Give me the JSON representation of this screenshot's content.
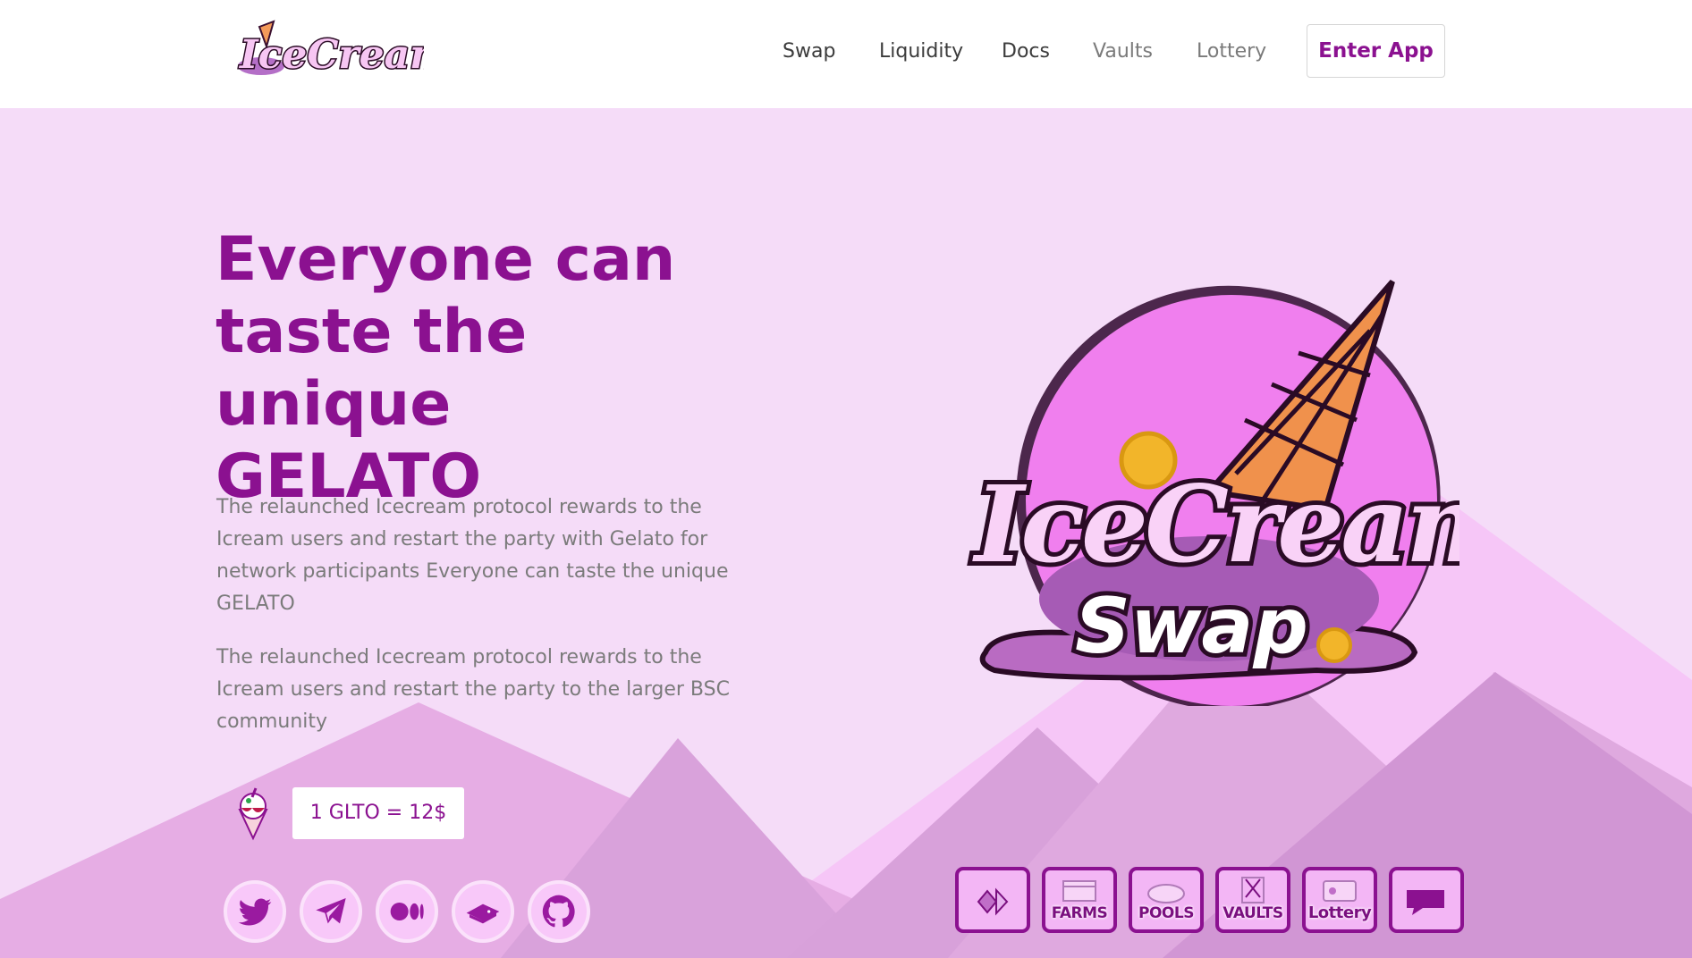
{
  "header": {
    "logo_text": "IceCream",
    "nav": [
      {
        "label": "Swap",
        "muted": false
      },
      {
        "label": "Liquidity",
        "muted": false
      },
      {
        "label": "Docs",
        "muted": false
      },
      {
        "label": "Vaults",
        "muted": true
      },
      {
        "label": "Lottery",
        "muted": true
      }
    ],
    "enter_app_label": "Enter App"
  },
  "hero": {
    "title_lines": [
      "Everyone can",
      "taste the unique",
      "GELATO"
    ],
    "paragraph_1": "The relaunched Icecream protocol rewards to the Icream users and restart the party with Gelato for network participants Everyone can taste the unique GELATO",
    "paragraph_2": "The relaunched Icecream protocol rewards to the Icream users and restart the party to the larger BSC community",
    "price": "1 GLTO = 12$",
    "art_text": {
      "line1": "IceCream",
      "line2": "Swap"
    }
  },
  "social_links": [
    {
      "icon": "twitter-icon"
    },
    {
      "icon": "telegram-icon"
    },
    {
      "icon": "medium-icon"
    },
    {
      "icon": "gitbook-icon"
    },
    {
      "icon": "github-icon"
    }
  ],
  "features": [
    {
      "icon": "bridge-icon",
      "label": ""
    },
    {
      "icon": "farms-icon",
      "label": "FARMS"
    },
    {
      "icon": "pools-icon",
      "label": "POOLS"
    },
    {
      "icon": "vaults-icon",
      "label": "VAULTS"
    },
    {
      "icon": "lottery-icon",
      "label": "Lottery"
    },
    {
      "icon": "chat-icon",
      "label": ""
    }
  ],
  "colors": {
    "brand": "#8b1190",
    "background": "#f5dcf8",
    "text_muted": "#7b7b7b"
  }
}
